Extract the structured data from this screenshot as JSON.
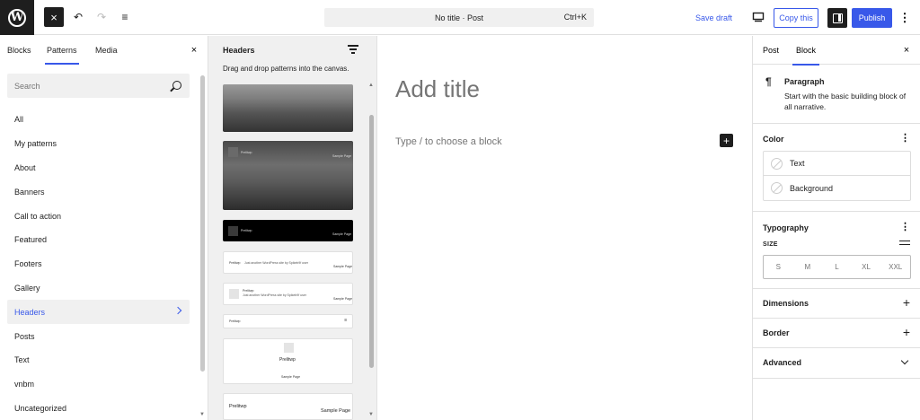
{
  "topbar": {
    "logo_letter": "W",
    "close_icon": "×",
    "undo_icon": "↶",
    "redo_icon": "↷",
    "list_icon": "≡",
    "command_title": "No title · Post",
    "command_shortcut": "Ctrl+K",
    "save_draft": "Save draft",
    "copy_this": "Copy this",
    "publish": "Publish",
    "more_icon": "⋮"
  },
  "inserter": {
    "tabs": [
      "Blocks",
      "Patterns",
      "Media"
    ],
    "active_tab": "Patterns",
    "search_placeholder": "Search",
    "categories": [
      "All",
      "My patterns",
      "About",
      "Banners",
      "Call to action",
      "Featured",
      "Footers",
      "Gallery",
      "Headers",
      "Posts",
      "Text",
      "vnbm",
      "Uncategorized"
    ],
    "active_category": "Headers"
  },
  "patterns_panel": {
    "title": "Headers",
    "description": "Drag and drop patterns into the canvas.",
    "site_title": "Prelitwp",
    "sample_page": "Sample Page",
    "tagline": "Just another WordPress site by Spikeb9f user",
    "tagline_short": "Just another WordPress site by Spikeb9f user"
  },
  "canvas": {
    "title_placeholder": "Add title",
    "block_hint": "Type / to choose a block",
    "add_icon": "+"
  },
  "sidebar": {
    "tabs": [
      "Post",
      "Block"
    ],
    "active_tab": "Block",
    "block_name": "Paragraph",
    "block_description": "Start with the basic building block of all narrative.",
    "color_label": "Color",
    "color_options": [
      "Text",
      "Background"
    ],
    "typography_label": "Typography",
    "size_label": "SIZE",
    "sizes": [
      "S",
      "M",
      "L",
      "XL",
      "XXL"
    ],
    "dimensions_label": "Dimensions",
    "border_label": "Border",
    "advanced_label": "Advanced"
  },
  "colors": {
    "accent": "#3858e9",
    "dark": "#1e1e1e"
  }
}
